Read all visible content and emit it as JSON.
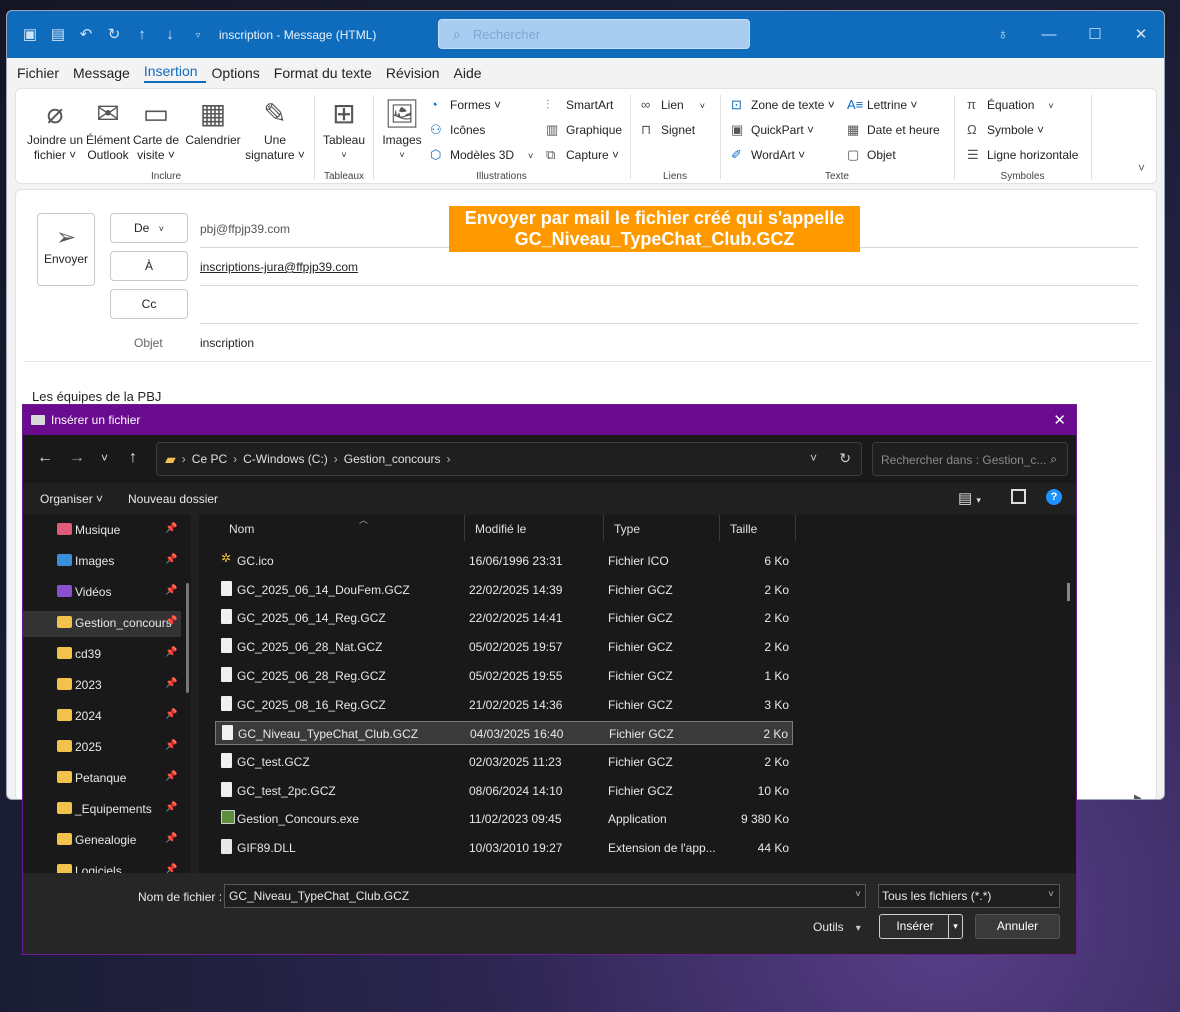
{
  "outlook": {
    "title": "inscription  -  Message (HTML)",
    "search_placeholder": "Rechercher",
    "menu": [
      "Fichier",
      "Message",
      "Insertion",
      "Options",
      "Format du texte",
      "Révision",
      "Aide"
    ],
    "ribbon": {
      "inclure": {
        "label": "Inclure",
        "joindre_1": "Joindre un",
        "joindre_2": "fichier ˅",
        "element_1": "Élément",
        "element_2": "Outlook",
        "carte_1": "Carte de",
        "carte_2": "visite ˅",
        "calendrier": "Calendrier",
        "signature_1": "Une",
        "signature_2": "signature ˅"
      },
      "tableaux": {
        "label": "Tableaux",
        "tableau": "Tableau"
      },
      "illustrations": {
        "label": "Illustrations",
        "images": "Images",
        "formes": "Formes ˅",
        "icones": "Icônes",
        "modeles3d": "Modèles 3D",
        "smartart": "SmartArt",
        "graphique": "Graphique",
        "capture": "Capture ˅"
      },
      "liens": {
        "label": "Liens",
        "lien": "Lien",
        "signet": "Signet"
      },
      "texte": {
        "label": "Texte",
        "zone": "Zone de texte ˅",
        "quickpart": "QuickPart ˅",
        "wordart": "WordArt ˅",
        "lettrine": "Lettrine ˅",
        "date": "Date et heure",
        "objet": "Objet"
      },
      "symboles": {
        "label": "Symboles",
        "equation": "Équation",
        "symbole": "Symbole ˅",
        "ligne": "Ligne horizontale"
      }
    },
    "compose": {
      "send": "Envoyer",
      "from_btn": "De",
      "from_value": "pbj@ffpjp39.com",
      "to_btn": "À",
      "to_value": "inscriptions-jura@ffpjp39.com",
      "cc_btn": "Cc",
      "subject_label": "Objet",
      "subject_value": "inscription",
      "body": "Les équipes de la PBJ",
      "annotation_1": "Envoyer par mail le fichier créé qui s'appelle",
      "annotation_2": "GC_Niveau_TypeChat_Club.GCZ"
    }
  },
  "dialog": {
    "title": "Insérer un fichier",
    "breadcrumb": [
      "Ce PC",
      "C-Windows (C:)",
      "Gestion_concours"
    ],
    "search_placeholder": "Rechercher dans : Gestion_c...",
    "organiser": "Organiser ˅",
    "nouveau_dossier": "Nouveau dossier",
    "nav_items": [
      {
        "label": "Musique",
        "color": "#e05a7a"
      },
      {
        "label": "Images",
        "color": "#3a8fd8"
      },
      {
        "label": "Vidéos",
        "color": "#8a4fd0"
      },
      {
        "label": "Gestion_concours",
        "color": "#f2c24d"
      },
      {
        "label": "cd39",
        "color": "#f2c24d"
      },
      {
        "label": "2023",
        "color": "#f2c24d"
      },
      {
        "label": "2024",
        "color": "#f2c24d"
      },
      {
        "label": "2025",
        "color": "#f2c24d"
      },
      {
        "label": "Petanque",
        "color": "#f2c24d"
      },
      {
        "label": "_Equipements",
        "color": "#f2c24d"
      },
      {
        "label": "Genealogie",
        "color": "#f2c24d"
      },
      {
        "label": "Logiciels",
        "color": "#f2c24d"
      }
    ],
    "columns": {
      "name": "Nom",
      "modified": "Modifié le",
      "type": "Type",
      "size": "Taille"
    },
    "files": [
      {
        "name": "GC.ico",
        "modified": "16/06/1996 23:31",
        "type": "Fichier ICO",
        "size": "6 Ko",
        "icon": "ico"
      },
      {
        "name": "GC_2025_06_14_DouFem.GCZ",
        "modified": "22/02/2025 14:39",
        "type": "Fichier GCZ",
        "size": "2 Ko",
        "icon": "doc"
      },
      {
        "name": "GC_2025_06_14_Reg.GCZ",
        "modified": "22/02/2025 14:41",
        "type": "Fichier GCZ",
        "size": "2 Ko",
        "icon": "doc"
      },
      {
        "name": "GC_2025_06_28_Nat.GCZ",
        "modified": "05/02/2025 19:57",
        "type": "Fichier GCZ",
        "size": "2 Ko",
        "icon": "doc"
      },
      {
        "name": "GC_2025_06_28_Reg.GCZ",
        "modified": "05/02/2025 19:55",
        "type": "Fichier GCZ",
        "size": "1 Ko",
        "icon": "doc"
      },
      {
        "name": "GC_2025_08_16_Reg.GCZ",
        "modified": "21/02/2025 14:36",
        "type": "Fichier GCZ",
        "size": "3 Ko",
        "icon": "doc"
      },
      {
        "name": "GC_Niveau_TypeChat_Club.GCZ",
        "modified": "04/03/2025 16:40",
        "type": "Fichier GCZ",
        "size": "2 Ko",
        "icon": "doc",
        "selected": true
      },
      {
        "name": "GC_test.GCZ",
        "modified": "02/03/2025 11:23",
        "type": "Fichier GCZ",
        "size": "2 Ko",
        "icon": "doc"
      },
      {
        "name": "GC_test_2pc.GCZ",
        "modified": "08/06/2024 14:10",
        "type": "Fichier GCZ",
        "size": "10 Ko",
        "icon": "doc"
      },
      {
        "name": "Gestion_Concours.exe",
        "modified": "11/02/2023 09:45",
        "type": "Application",
        "size": "9 380 Ko",
        "icon": "exe"
      },
      {
        "name": "GIF89.DLL",
        "modified": "10/03/2010 19:27",
        "type": "Extension de l'app...",
        "size": "44 Ko",
        "icon": "dll"
      }
    ],
    "filename_label": "Nom de fichier :",
    "filename_value": "GC_Niveau_TypeChat_Club.GCZ",
    "filetype": "Tous les fichiers (*.*)",
    "outils": "Outils",
    "inserer": "Insérer",
    "annuler": "Annuler"
  }
}
